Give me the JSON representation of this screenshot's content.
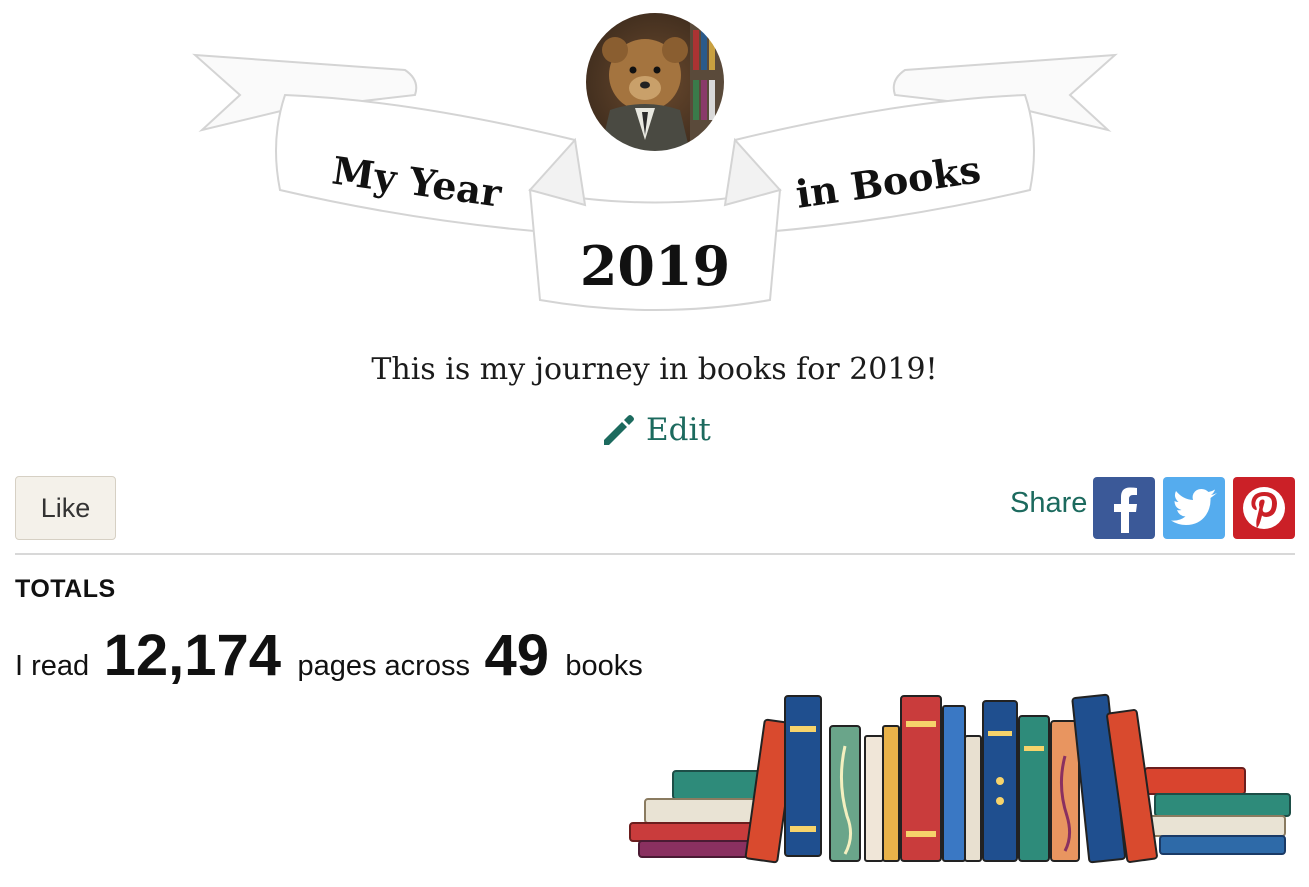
{
  "banner": {
    "left_text": "My Year",
    "right_text": "in Books",
    "year": "2019"
  },
  "profile": {
    "avatar_alt": "teddy bear avatar"
  },
  "description": "This is my journey in books for 2019!",
  "edit_label": "Edit",
  "like_label": "Like",
  "share": {
    "label": "Share",
    "networks": [
      "facebook",
      "twitter",
      "pinterest"
    ],
    "colors": {
      "facebook": "#3b5998",
      "twitter": "#55acee",
      "pinterest": "#cb2027"
    }
  },
  "totals": {
    "heading": "TOTALS",
    "prefix": "I read",
    "pages": "12,174",
    "middle": "pages across",
    "books": "49",
    "suffix": "books"
  },
  "colors": {
    "accent": "#1c6a5e",
    "like_bg": "#f4f1ea"
  }
}
